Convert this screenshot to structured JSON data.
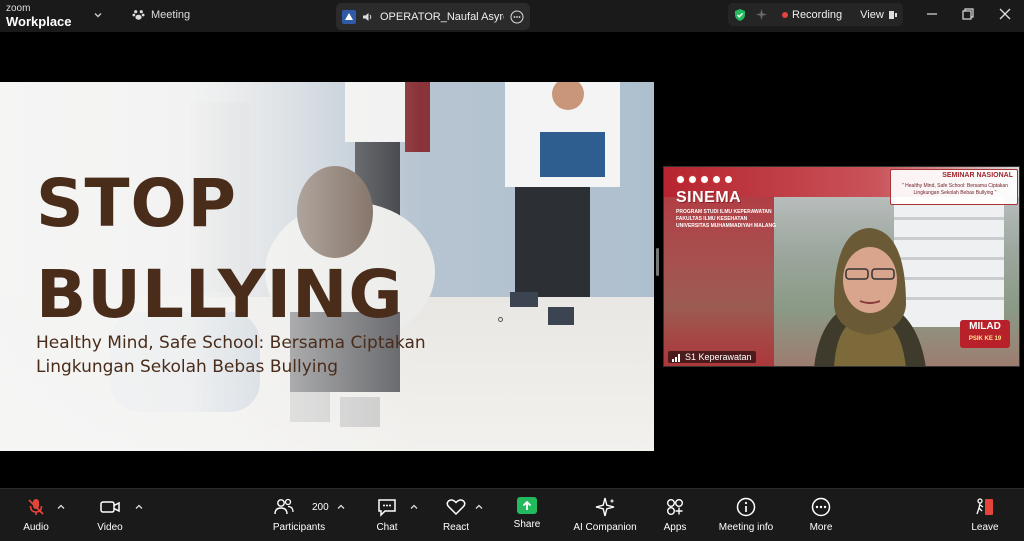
{
  "app": {
    "brand_line1": "zoom",
    "brand_line2": "Workplace"
  },
  "meeting_tab": {
    "label": "Meeting"
  },
  "active_speaker": {
    "name": "OPERATOR_Naufal Asyrof AL"
  },
  "status": {
    "recording_label": "Recording",
    "view_label": "View",
    "colors": {
      "recording_dot": "#e5443b",
      "shield": "#22b95f"
    }
  },
  "slide": {
    "title_line1": "STOP",
    "title_line2": "BULLYING",
    "subtitle_line1": "Healthy Mind, Safe School: Bersama Ciptakan",
    "subtitle_line2": "Lingkungan Sekolah Bebas Bullying",
    "colors": {
      "title": "#4a2c1b"
    }
  },
  "video_tile": {
    "participant_name": "S1 Keperawatan",
    "banner": {
      "seminar_title": "SEMINAR NASIONAL",
      "seminar_line1": "\" Healthy Mind, Safe School: Bersama Ciptakan",
      "seminar_line2": "Lingkungan Sekolah Bebas Bullying \"",
      "event_name": "SINEMA",
      "org_line1": "PROGRAM STUDI ILMU KEPERAWATAN",
      "org_line2": "FAKULTAS ILMU KESEHATAN",
      "org_line3": "UNIVERSITAS MUHAMMADIYAH MALANG",
      "milad_title": "MILAD",
      "milad_sub": "PSIK KE 19"
    }
  },
  "toolbar": {
    "audio": "Audio",
    "video": "Video",
    "participants": "Participants",
    "participants_count": "200",
    "chat": "Chat",
    "react": "React",
    "share": "Share",
    "ai_companion": "AI Companion",
    "apps": "Apps",
    "meeting_info": "Meeting info",
    "more": "More",
    "leave": "Leave",
    "icons": {
      "audio": "microphone-muted-icon",
      "video": "video-camera-icon",
      "participants": "people-icon",
      "chat": "chat-bubble-icon",
      "react": "heart-icon",
      "share": "share-screen-icon",
      "ai_companion": "sparkle-icon",
      "apps": "apps-icon",
      "meeting_info": "info-icon",
      "more": "more-dots-icon",
      "leave": "exit-door-icon"
    },
    "colors": {
      "mic_muted": "#e5443b",
      "share": "#22b95f",
      "leave": "#e5443b"
    }
  }
}
